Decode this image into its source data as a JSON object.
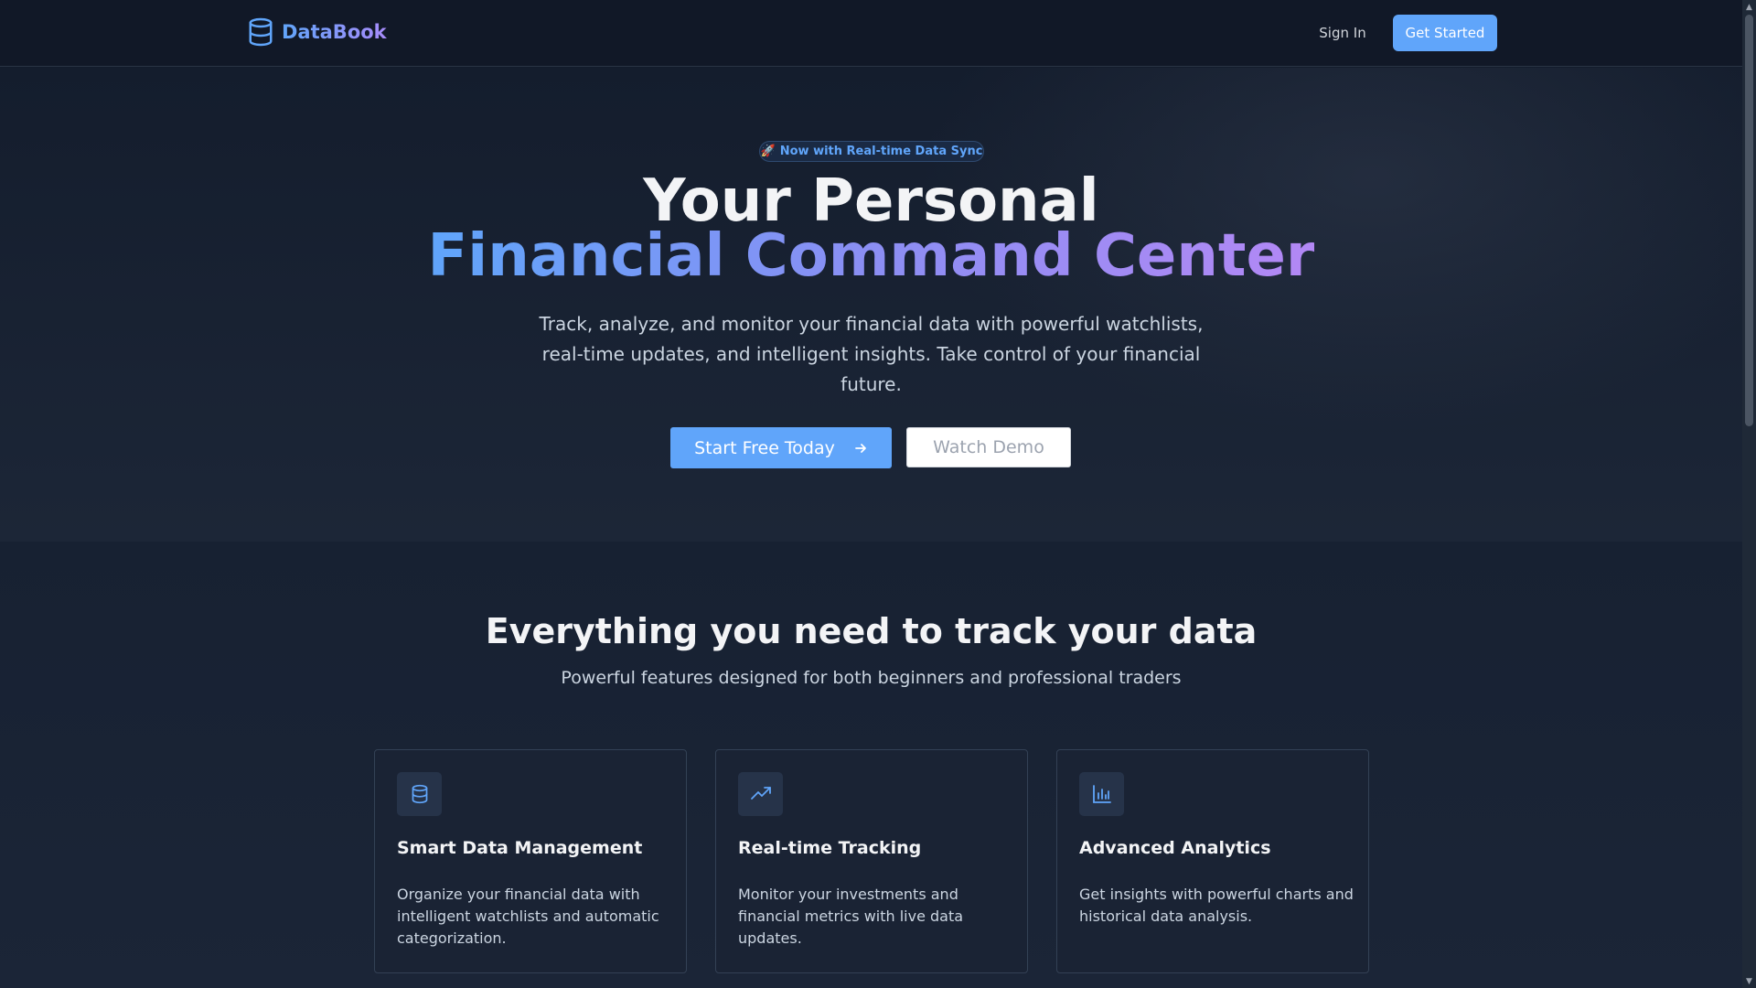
{
  "header": {
    "brand": "DataBook",
    "sign_in": "Sign In",
    "get_started": "Get Started"
  },
  "hero": {
    "badge_icon": "🚀",
    "badge_text": "Now with Real-time Data Sync",
    "title_line1": "Your Personal",
    "title_line2": "Financial Command Center",
    "subtitle": "Track, analyze, and monitor your financial data with powerful watchlists, real-time updates, and intelligent insights. Take control of your financial future.",
    "primary_cta": "Start Free Today",
    "secondary_cta": "Watch Demo"
  },
  "features": {
    "title": "Everything you need to track your data",
    "subtitle": "Powerful features designed for both beginners and professional traders",
    "cards": [
      {
        "icon": "database-icon",
        "title": "Smart Data Management",
        "description": "Organize your financial data with intelligent watchlists and automatic categorization."
      },
      {
        "icon": "trending-up-icon",
        "title": "Real-time Tracking",
        "description": "Monitor your investments and financial metrics with live data updates."
      },
      {
        "icon": "bar-chart-icon",
        "title": "Advanced Analytics",
        "description": "Get insights with powerful charts and historical data analysis."
      }
    ]
  },
  "colors": {
    "accent": "#60a5fa",
    "gradient_end": "#a78bfa",
    "background": "#111827"
  }
}
